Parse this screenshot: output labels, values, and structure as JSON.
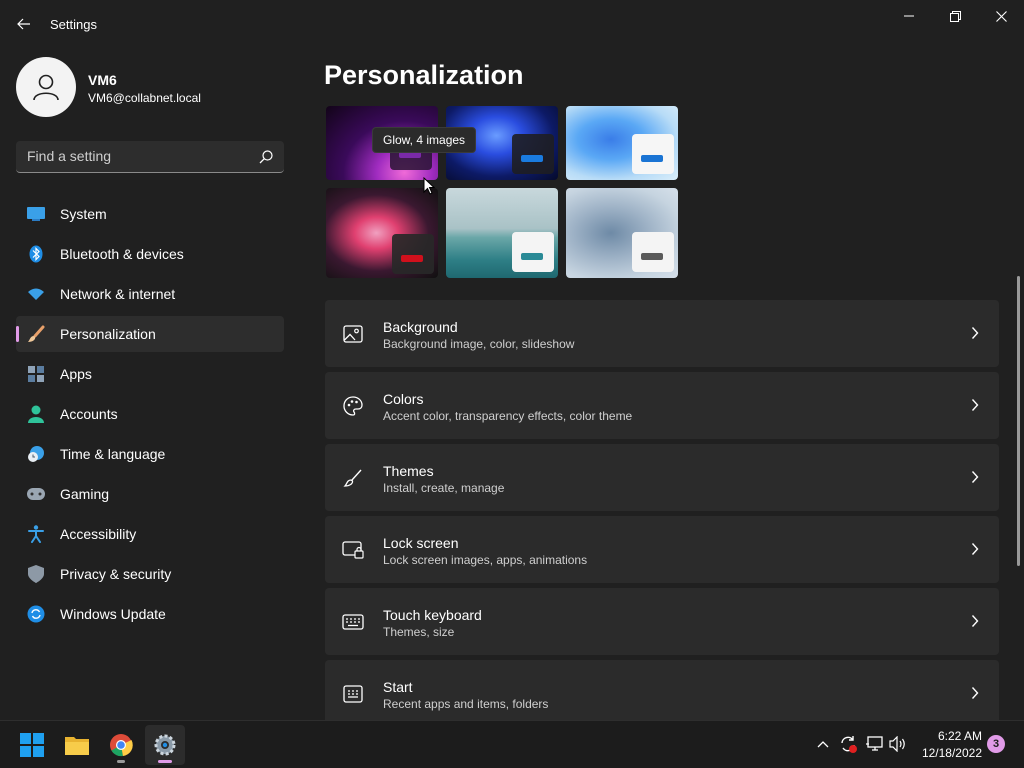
{
  "window": {
    "title": "Settings"
  },
  "profile": {
    "name": "VM6",
    "email": "VM6@collabnet.local"
  },
  "search": {
    "placeholder": "Find a setting"
  },
  "nav": {
    "items": [
      {
        "label": "System",
        "icon": "system-icon"
      },
      {
        "label": "Bluetooth & devices",
        "icon": "bluetooth-icon"
      },
      {
        "label": "Network & internet",
        "icon": "wifi-icon"
      },
      {
        "label": "Personalization",
        "icon": "paintbrush-icon",
        "selected": true
      },
      {
        "label": "Apps",
        "icon": "apps-icon"
      },
      {
        "label": "Accounts",
        "icon": "accounts-icon"
      },
      {
        "label": "Time & language",
        "icon": "clock-globe-icon"
      },
      {
        "label": "Gaming",
        "icon": "controller-icon"
      },
      {
        "label": "Accessibility",
        "icon": "accessibility-icon"
      },
      {
        "label": "Privacy & security",
        "icon": "shield-icon"
      },
      {
        "label": "Windows Update",
        "icon": "windows-update-icon"
      }
    ]
  },
  "main": {
    "title": "Personalization",
    "tooltip": "Glow, 4 images",
    "settings": [
      {
        "title": "Background",
        "subtitle": "Background image, color, slideshow",
        "icon": "image-icon"
      },
      {
        "title": "Colors",
        "subtitle": "Accent color, transparency effects, color theme",
        "icon": "palette-icon"
      },
      {
        "title": "Themes",
        "subtitle": "Install, create, manage",
        "icon": "brush-icon"
      },
      {
        "title": "Lock screen",
        "subtitle": "Lock screen images, apps, animations",
        "icon": "lock-screen-icon"
      },
      {
        "title": "Touch keyboard",
        "subtitle": "Themes, size",
        "icon": "keyboard-icon"
      },
      {
        "title": "Start",
        "subtitle": "Recent apps and items, folders",
        "icon": "start-menu-icon"
      }
    ]
  },
  "taskbar": {
    "time": "6:22 AM",
    "date": "12/18/2022",
    "notifications": "3"
  },
  "colors": {
    "accent": "#e19be8",
    "background": "#202020",
    "card": "#2b2b2b"
  }
}
